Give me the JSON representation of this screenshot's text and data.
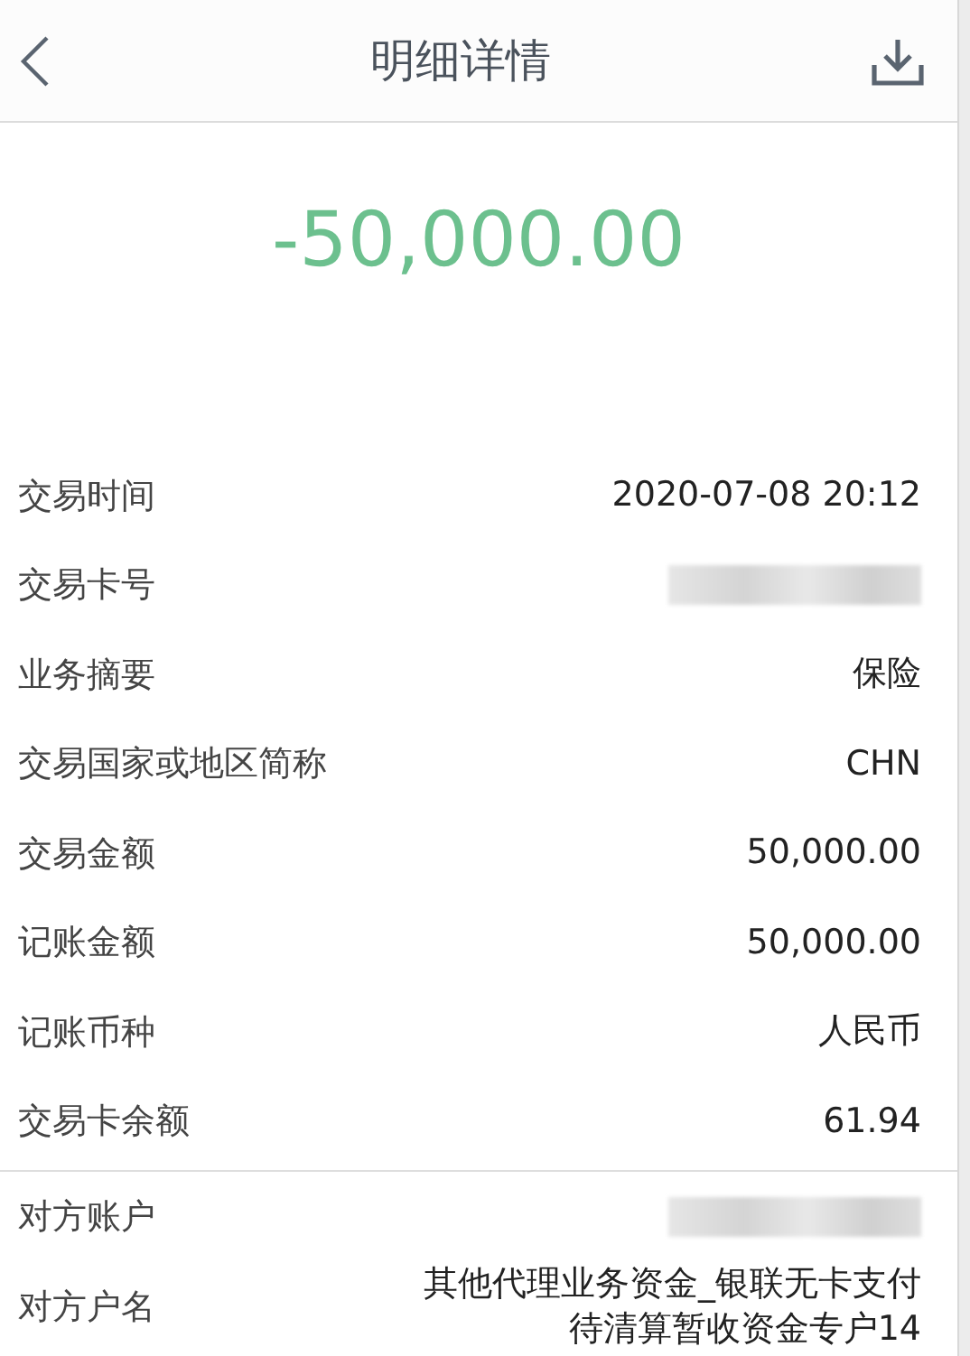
{
  "header": {
    "title": "明细详情"
  },
  "amount": "-50,000.00",
  "sections": [
    [
      {
        "label": "交易时间",
        "kind": "text",
        "value": "2020-07-08 20:12"
      },
      {
        "label": "交易卡号",
        "kind": "masked"
      },
      {
        "label": "业务摘要",
        "kind": "text",
        "value": "保险"
      },
      {
        "label": "交易国家或地区简称",
        "kind": "text",
        "value": "CHN"
      },
      {
        "label": "交易金额",
        "kind": "text",
        "value": "50,000.00"
      },
      {
        "label": "记账金额",
        "kind": "text",
        "value": "50,000.00"
      },
      {
        "label": "记账币种",
        "kind": "text",
        "value": "人民币"
      },
      {
        "label": "交易卡余额",
        "kind": "text",
        "value": "61.94"
      }
    ],
    [
      {
        "label": "对方账户",
        "kind": "masked"
      },
      {
        "label": "对方户名",
        "kind": "text",
        "value": "其他代理业务资金_银联无卡支付待清算暂收资金专户14"
      }
    ]
  ]
}
